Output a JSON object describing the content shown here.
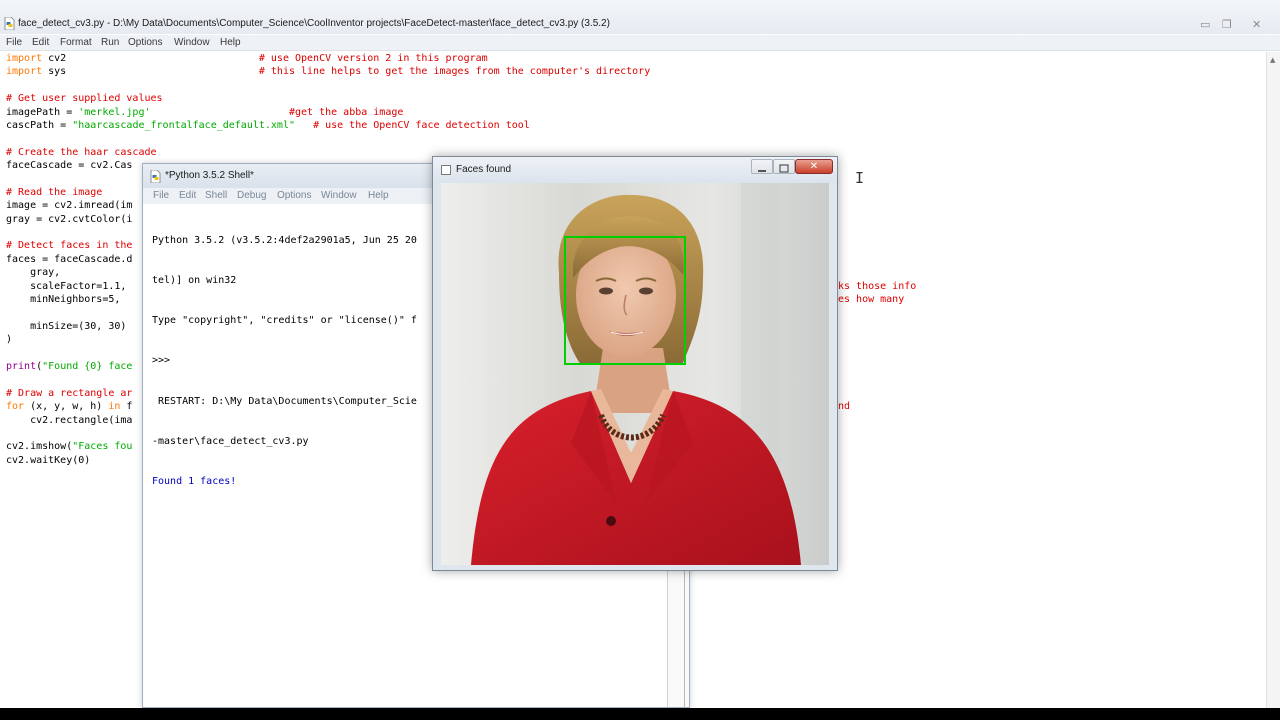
{
  "editor": {
    "title": "face_detect_cv3.py - D:\\My Data\\Documents\\Computer_Science\\CoolInventor projects\\FaceDetect-master\\face_detect_cv3.py (3.5.2)",
    "menu": [
      "File",
      "Edit",
      "Format",
      "Run",
      "Options",
      "Window",
      "Help"
    ],
    "code_lines": [
      [
        {
          "t": "import",
          "c": "kw"
        },
        {
          "t": " cv2                                "
        },
        {
          "t": "# use OpenCV version 2 in this program",
          "c": "cm"
        }
      ],
      [
        {
          "t": "import",
          "c": "kw"
        },
        {
          "t": " sys                                "
        },
        {
          "t": "# this line helps to get the images from the computer's directory",
          "c": "cm"
        }
      ],
      [],
      [
        {
          "t": "# Get user supplied values",
          "c": "cm"
        }
      ],
      [
        {
          "t": "imagePath = "
        },
        {
          "t": "'merkel.jpg'",
          "c": "st"
        },
        {
          "t": "                       "
        },
        {
          "t": "#get the abba image",
          "c": "cm"
        }
      ],
      [
        {
          "t": "cascPath = "
        },
        {
          "t": "\"haarcascade_frontalface_default.xml\"",
          "c": "st"
        },
        {
          "t": "   "
        },
        {
          "t": "# use the OpenCV face detection tool",
          "c": "cm"
        }
      ],
      [],
      [
        {
          "t": "# Create the haar cascade",
          "c": "cm"
        }
      ],
      [
        {
          "t": "faceCascade = cv2.Cas"
        }
      ],
      [],
      [
        {
          "t": "# Read the image",
          "c": "cm"
        }
      ],
      [
        {
          "t": "image = cv2.imread(im"
        }
      ],
      [
        {
          "t": "gray = cv2.cvtColor(i"
        }
      ],
      [],
      [
        {
          "t": "# Detect faces in the",
          "c": "cm"
        }
      ],
      [
        {
          "t": "faces = faceCascade.d"
        }
      ],
      [
        {
          "t": "    gray,"
        }
      ],
      [
        {
          "t": "    scaleFactor=1.1,"
        }
      ],
      [
        {
          "t": "    minNeighbors=5,"
        }
      ],
      [],
      [
        {
          "t": "    minSize=(30, 30)"
        }
      ],
      [
        {
          "t": ")"
        }
      ],
      [],
      [
        {
          "t": "print",
          "c": "bi"
        },
        {
          "t": "("
        },
        {
          "t": "\"Found {0} face",
          "c": "st"
        }
      ],
      [],
      [
        {
          "t": "# Draw a rectangle ar",
          "c": "cm"
        }
      ],
      [
        {
          "t": "for",
          "c": "kw"
        },
        {
          "t": " (x, y, w, h) "
        },
        {
          "t": "in",
          "c": "kw"
        },
        {
          "t": " f"
        }
      ],
      [
        {
          "t": "    cv2.rectangle(ima"
        }
      ],
      [],
      [
        {
          "t": "cv2.imshow("
        },
        {
          "t": "\"Faces fou",
          "c": "st"
        }
      ],
      [
        {
          "t": "cv2.waitKey(0)"
        }
      ]
    ],
    "right_fragments": {
      "line1": "ks those info",
      "line2": "es how many",
      "line3": "nd"
    }
  },
  "shell": {
    "title": "*Python 3.5.2 Shell*",
    "menu": [
      "File",
      "Edit",
      "Shell",
      "Debug",
      "Options",
      "Window",
      "Help"
    ],
    "lines": [
      "Python 3.5.2 (v3.5.2:4def2a2901a5, Jun 25 20",
      "tel)] on win32",
      "Type \"copyright\", \"credits\" or \"license()\" f",
      ">>> ",
      " RESTART: D:\\My Data\\Documents\\Computer_Scie",
      "-master\\face_detect_cv3.py"
    ],
    "output": "Found 1 faces!"
  },
  "faces_window": {
    "title": "Faces found",
    "close_glyph": "✕"
  },
  "colors": {
    "keyword": "#ff7700",
    "comment": "#dd0000",
    "string": "#00aa00",
    "builtin": "#900090",
    "shell_output": "#0000c0",
    "detection_box": "#00d000"
  }
}
